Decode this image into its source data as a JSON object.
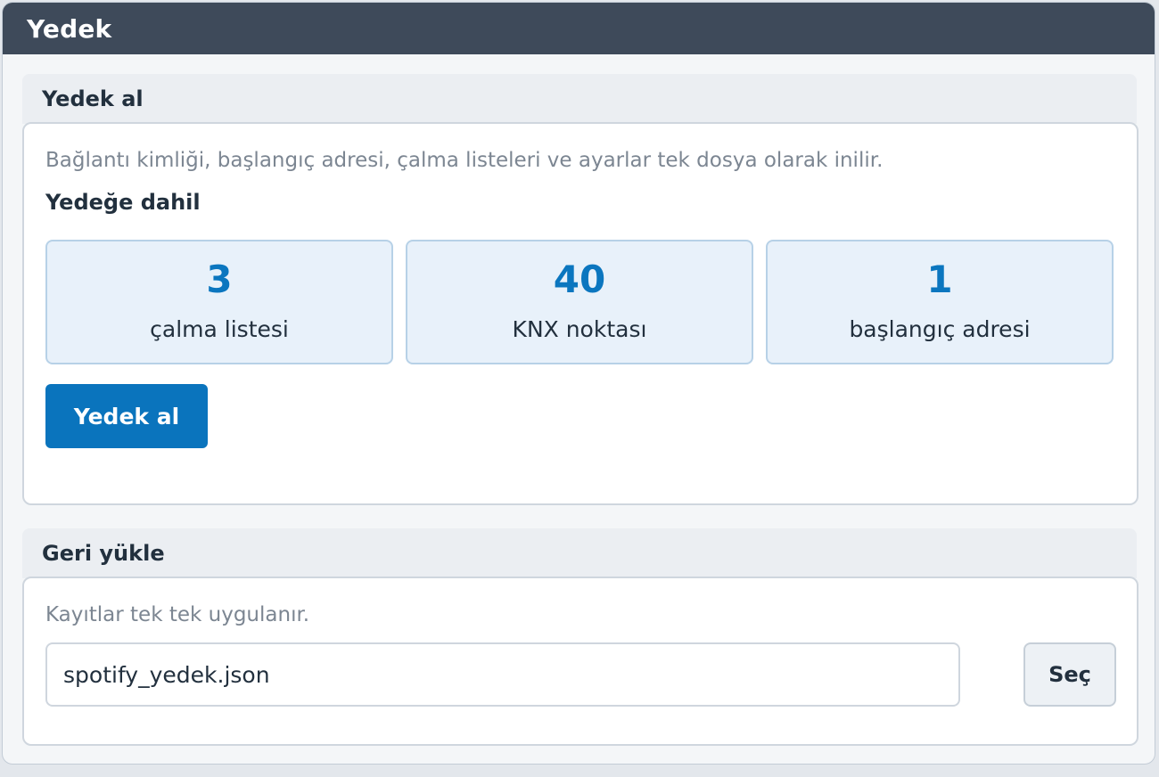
{
  "window": {
    "title": "Yedek"
  },
  "backup": {
    "heading": "Yedek al",
    "description": "Bağlantı kimliği, başlangıç adresi, çalma listeleri ve ayarlar tek dosya olarak inilir.",
    "included_label": "Yedeğe dahil",
    "stats": [
      {
        "value": "3",
        "label": "çalma listesi"
      },
      {
        "value": "40",
        "label": "KNX noktası"
      },
      {
        "value": "1",
        "label": "başlangıç adresi"
      }
    ],
    "button_label": "Yedek al"
  },
  "restore": {
    "heading": "Geri yükle",
    "description": "Kayıtlar tek tek uygulanır.",
    "file_value": "spotify_yedek.json",
    "choose_button_label": "Seç"
  },
  "colors": {
    "titlebar": "#3e4a5a",
    "accent": "#0a74bd",
    "stat_value": "#0b76bf",
    "stat_background": "#e8f1fa"
  }
}
